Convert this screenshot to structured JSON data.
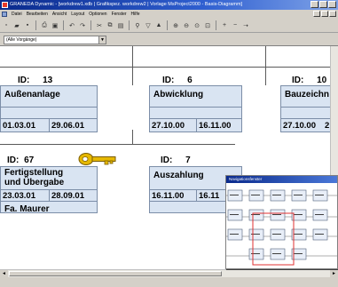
{
  "window": {
    "title": "GRANEDA Dynamic - [workdrew1.xdb | Grafikspez. workdrew2 | Vorlage MsProject2000 - Basis-Diagramm]"
  },
  "menu": {
    "items": [
      "Datei",
      "Bearbeiten",
      "Ansicht",
      "Layout",
      "Optionen",
      "Fenster",
      "Hilfe"
    ]
  },
  "toolbar": {
    "icons": [
      "new-icon",
      "open-icon",
      "save-icon",
      "print-icon",
      "preview-icon",
      "undo-icon",
      "redo-icon",
      "cut-icon",
      "copy-icon",
      "paste-icon",
      "find-icon",
      "zoom-icon",
      "filter-icon",
      "zoom-in-icon",
      "zoom-out-icon"
    ]
  },
  "filter": {
    "value": "(Alle Vorgänge)",
    "arrow": "▼"
  },
  "nodes": [
    {
      "id_label": "ID:",
      "id": "13",
      "name": "Außenanlage",
      "start": "01.03.01",
      "end": "29.06.01"
    },
    {
      "id_label": "ID:",
      "id": "6",
      "name": "Abwicklung",
      "start": "27.10.00",
      "end": "16.11.00"
    },
    {
      "id_label": "ID:",
      "id": "10",
      "name": "Bauzeichn",
      "start": "27.10.00",
      "end": "2"
    },
    {
      "id_label": "ID:",
      "id": "67",
      "name": "Fertigstellung",
      "name2": "und Übergabe",
      "start": "23.03.01",
      "end": "28.09.01",
      "extra": "Fa. Maurer"
    },
    {
      "id_label": "ID:",
      "id": "7",
      "name": "Auszahlung",
      "start": "16.11.00",
      "end": "16.11"
    }
  ],
  "navigator": {
    "title": "Navigationsfenster"
  },
  "scroll": {
    "left": "◄",
    "right": "►"
  },
  "colors": {
    "node_fill": "#d9e4f2",
    "key": "#e6b800",
    "nav_highlight": "#e03030"
  }
}
